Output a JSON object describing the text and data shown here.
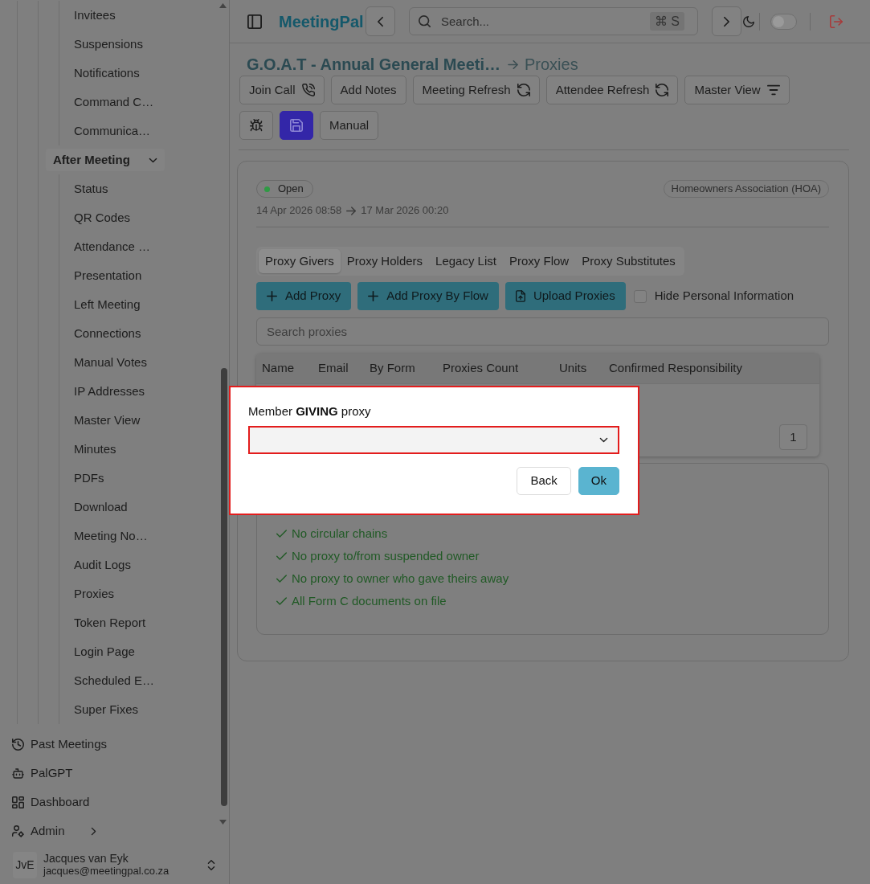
{
  "topbar": {
    "brand": "MeetingPal",
    "search": {
      "placeholder": "Search...",
      "shortcut": "⌘ S"
    },
    "theme_switch": {
      "on": false
    }
  },
  "sidebar": {
    "tree": [
      {
        "children": [
          {
            "children": [
              {
                "children": [
                  {
                    "label": "Invitees"
                  },
                  {
                    "label": "Suspensions"
                  },
                  {
                    "label": "Notifications"
                  },
                  {
                    "label": "Command C…"
                  },
                  {
                    "label": "Communica…"
                  }
                ]
              },
              {
                "label": "After Meeting",
                "expanded": true,
                "children": [
                  {
                    "label": "Status"
                  },
                  {
                    "label": "QR Codes"
                  },
                  {
                    "label": "Attendance …"
                  },
                  {
                    "label": "Presentation"
                  },
                  {
                    "label": "Left Meeting"
                  },
                  {
                    "label": "Connections"
                  },
                  {
                    "label": "Manual Votes"
                  },
                  {
                    "label": "IP Addresses"
                  },
                  {
                    "label": "Master View"
                  },
                  {
                    "label": "Minutes"
                  },
                  {
                    "label": "PDFs"
                  },
                  {
                    "label": "Download"
                  },
                  {
                    "label": "Meeting No…"
                  },
                  {
                    "label": "Audit Logs"
                  },
                  {
                    "label": "Proxies"
                  },
                  {
                    "label": "Token Report"
                  },
                  {
                    "label": "Login Page"
                  },
                  {
                    "label": "Scheduled E…"
                  },
                  {
                    "label": "Super Fixes"
                  }
                ]
              }
            ]
          }
        ]
      }
    ],
    "items": [
      {
        "label": "Past Meetings"
      },
      {
        "label": "PalGPT"
      },
      {
        "label": "Dashboard"
      },
      {
        "label": "Admin",
        "expanded": false
      }
    ],
    "user": {
      "initials": "JvE",
      "name": "Jacques van Eyk",
      "email": "jacques@meetingpal.co.za"
    }
  },
  "header": {
    "breadcrumb": [
      "G.O.A.T - Annual General Meeti…",
      "Proxies"
    ],
    "toolbar": [
      [
        {
          "label": "Join Call"
        },
        {
          "label": "Add Notes"
        },
        {
          "label": "Meeting Refresh"
        },
        {
          "label": "Attendee Refresh"
        },
        {
          "label": "Master View"
        }
      ],
      [
        {
          "kind": "outline"
        },
        {
          "kind": "primary"
        },
        {
          "label": "Manual",
          "kind": "outline"
        }
      ]
    ]
  },
  "meeting": {
    "status": "Open",
    "organisation": "Homeowners Association (HOA)",
    "start": "14 Apr 2026 08:58",
    "end": "17 Mar 2026 00:20"
  },
  "proxies": {
    "tabs": [
      {
        "label": "Proxy Givers",
        "selected": true
      },
      {
        "label": "Proxy Holders",
        "selected": false
      },
      {
        "label": "Legacy List",
        "selected": false
      },
      {
        "label": "Proxy Flow",
        "selected": false
      },
      {
        "label": "Proxy Substitutes",
        "selected": false
      }
    ],
    "actions": [
      {
        "label": "Add Proxy"
      },
      {
        "label": "Add Proxy By Flow"
      },
      {
        "label": "Upload Proxies"
      }
    ],
    "hide_personal": {
      "label": "Hide Personal Information",
      "checked": false
    },
    "search": {
      "placeholder": "Search proxies"
    },
    "table": {
      "columns": [
        "Name",
        "Email",
        "By Form",
        "Proxies Count",
        "Units",
        "Confirmed Responsibility"
      ],
      "pagination": [
        "1"
      ]
    },
    "checks": [
      "No circular chains",
      "No proxy to/from suspended owner",
      "No proxy to owner who gave theirs away",
      "All Form C documents on file"
    ]
  },
  "modal": {
    "label": "Member **GIVING** proxy",
    "field": {
      "invalid": true
    },
    "buttons": [
      {
        "label": "Back",
        "kind": "secondary"
      },
      {
        "label": "Ok",
        "kind": "primary"
      }
    ]
  }
}
